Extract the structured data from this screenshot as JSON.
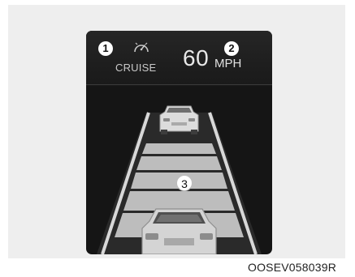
{
  "cluster": {
    "cruise": {
      "marker": "1",
      "icon": "cruise-control-speedometer-icon",
      "label": "CRUISE"
    },
    "speed": {
      "marker": "2",
      "value": "60",
      "unit": "MPH"
    },
    "following_distance": {
      "marker": "3",
      "icon_front": "lead-vehicle-icon",
      "icon_rear": "own-vehicle-icon"
    }
  },
  "image_code": "OOSEV058039R",
  "colors": {
    "cluster_bg": "#151515",
    "panel_bg": "#eeeeee",
    "lane_fill": "#bdbdbd",
    "text_light": "#e8e8e8"
  }
}
